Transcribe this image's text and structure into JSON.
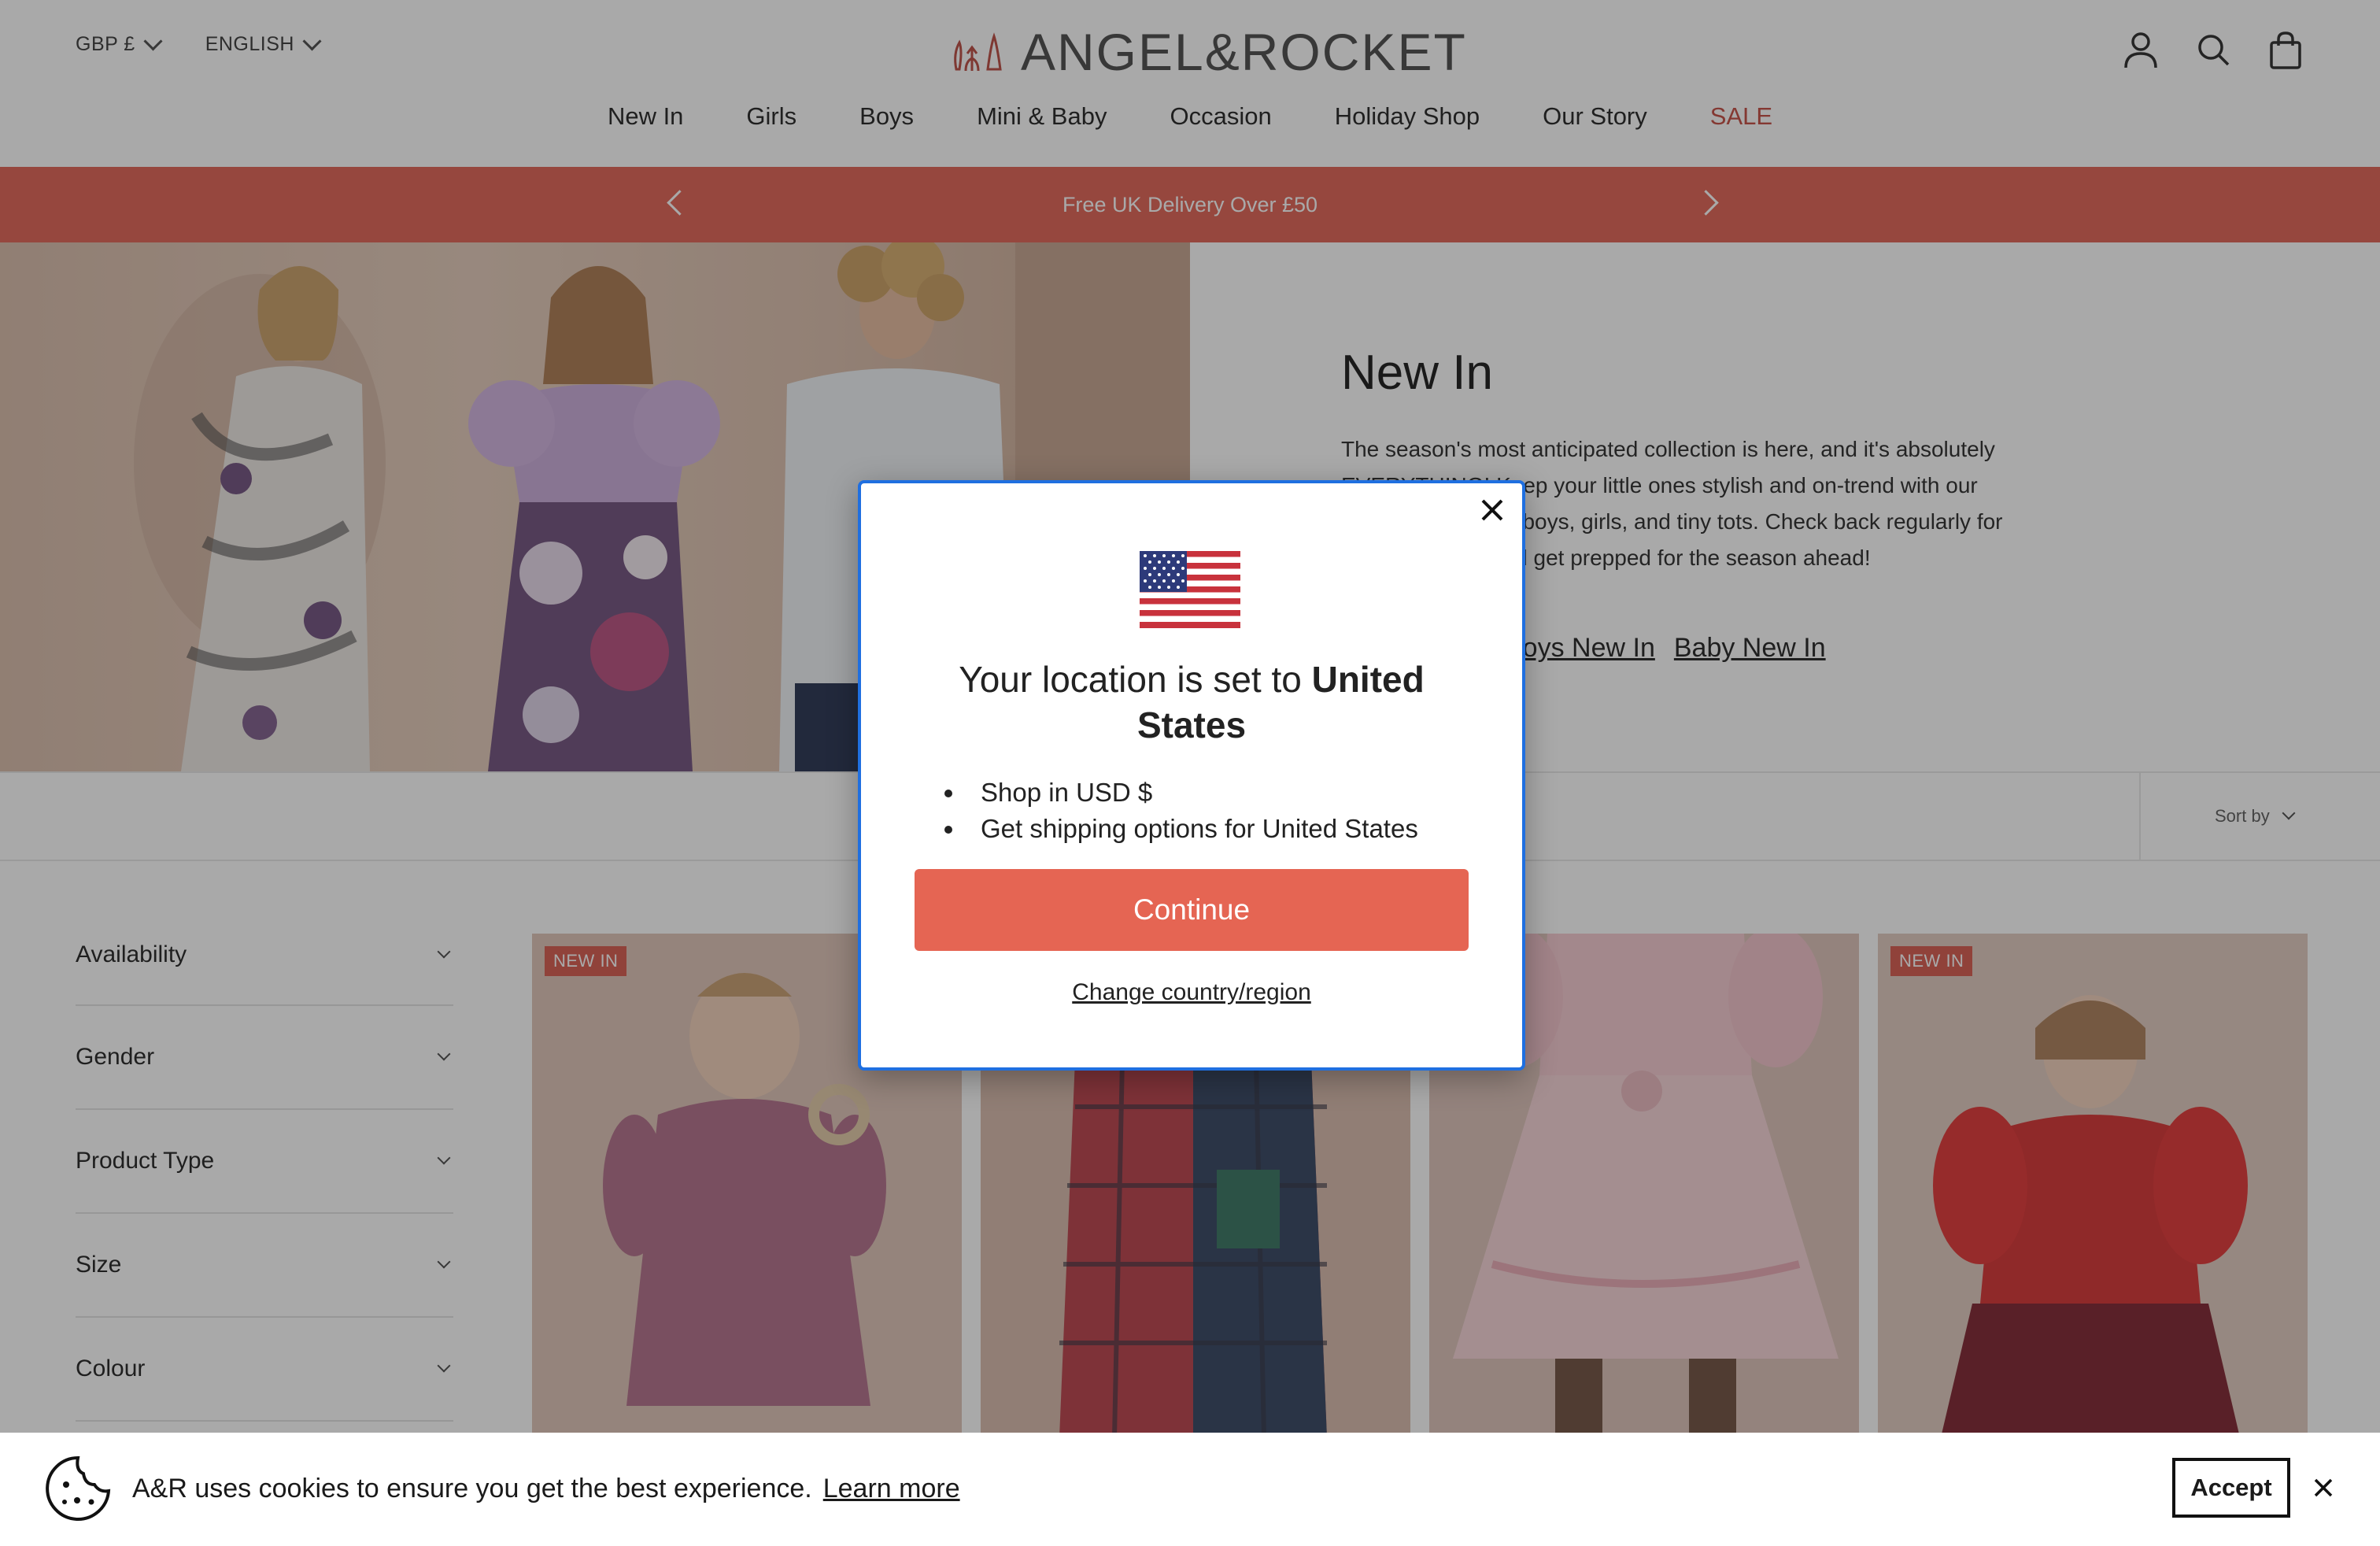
{
  "header": {
    "currency": "GBP £",
    "language": "ENGLISH",
    "logo_text": "ANGEL&ROCKET"
  },
  "nav": {
    "items": [
      "New In",
      "Girls",
      "Boys",
      "Mini & Baby",
      "Occasion",
      "Holiday Shop",
      "Our Story",
      "SALE"
    ]
  },
  "promo": {
    "text": "Free UK Delivery Over £50"
  },
  "hero": {
    "title": "New In",
    "description_visible_1": "The season's most anticipated collection is here, and it's absolutely",
    "description_visible_2": "EVERYTHING! Keep your little ones stylish and on-trend with our",
    "description_visible_3": "for boys, girls, and tiny tots. Check back regularly for",
    "description_visible_4": "and get prepped for the season ahead!",
    "link_boys": "Boys New In",
    "link_baby": "Baby New In"
  },
  "toolbar": {
    "sort_label": "Sort by"
  },
  "filters": [
    "Availability",
    "Gender",
    "Product Type",
    "Size",
    "Colour"
  ],
  "products": [
    {
      "badge": "NEW IN"
    },
    {
      "badge": ""
    },
    {
      "badge": ""
    },
    {
      "badge": "NEW IN"
    }
  ],
  "modal": {
    "title_prefix": "Your location is set to ",
    "country": "United States",
    "bullets": [
      "Shop in USD $",
      "Get shipping options for United States"
    ],
    "continue_label": "Continue",
    "change_label": "Change country/region"
  },
  "cookie": {
    "text": "A&R uses cookies to ensure you get the best experience.",
    "learn_more": "Learn more",
    "accept_label": "Accept"
  },
  "colors": {
    "promo": "#e05d4e",
    "continue": "#e56553",
    "badge": "#d65446",
    "sale": "#c1443a",
    "modal_border": "#1f6fe0"
  }
}
